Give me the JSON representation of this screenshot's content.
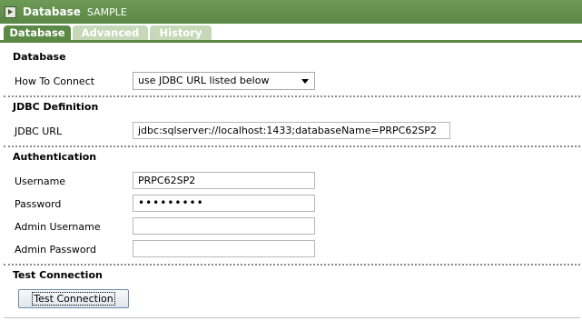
{
  "window": {
    "title": "Database",
    "subtitle": "SAMPLE"
  },
  "tabs": [
    {
      "label": "Database",
      "active": true
    },
    {
      "label": "Advanced",
      "active": false
    },
    {
      "label": "History",
      "active": false
    }
  ],
  "sections": {
    "database": {
      "heading": "Database",
      "how_to_connect_label": "How To Connect",
      "how_to_connect_value": "use JDBC URL listed below"
    },
    "jdbc": {
      "heading": "JDBC Definition",
      "url_label": "JDBC URL",
      "url_value": "jdbc:sqlserver://localhost:1433;databaseName=PRPC62SP2"
    },
    "auth": {
      "heading": "Authentication",
      "username_label": "Username",
      "username_value": "PRPC62SP2",
      "password_label": "Password",
      "password_value": "•••••••••",
      "admin_username_label": "Admin Username",
      "admin_username_value": "",
      "admin_password_label": "Admin Password",
      "admin_password_value": ""
    },
    "test": {
      "heading": "Test Connection",
      "button_label": "Test Connection"
    }
  },
  "colors": {
    "title_bar": "#5a8744",
    "tab_active": "#5b8a46",
    "tab_inactive": "#c5d8b7"
  }
}
